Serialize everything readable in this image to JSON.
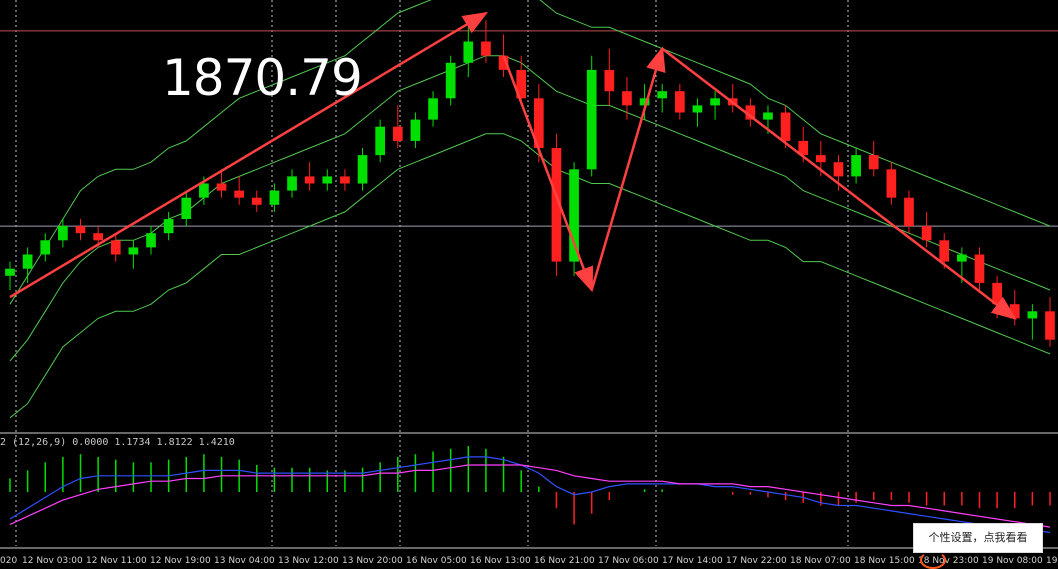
{
  "overlay_text": {
    "price_label": "1870.79",
    "indicator_label": "2 (12,26,9) 0.0000 1.1734 1.8122 1.4210",
    "toast_label": "个性设置，点我看看"
  },
  "colors": {
    "background": "#000000",
    "bull_candle": "#00e000",
    "bear_candle": "#ff2020",
    "band_line": "#50c850",
    "arrow": "#ff4040",
    "grid": "#c8c8c8",
    "macd_main": "#3050ff",
    "macd_signal": "#ff40ff"
  },
  "icons": {
    "toast_tail": "orange-arc-icon"
  },
  "chart_data": [
    {
      "type": "candlestick",
      "title": "",
      "x_tick_labels": [
        "020",
        "12 Nov 03:00",
        "12 Nov 11:00",
        "12 Nov 19:00",
        "13 Nov 04:00",
        "13 Nov 12:00",
        "13 Nov 20:00",
        "16 Nov 05:00",
        "16 Nov 13:00",
        "16 Nov 21:00",
        "17 Nov 06:00",
        "17 Nov 14:00",
        "17 Nov 22:00",
        "18 Nov 07:00",
        "18 Nov 15:00",
        "18 Nov 23:00",
        "19 Nov 08:00",
        "19"
      ],
      "vertical_grid_at_ticks": [
        1,
        5,
        6,
        7,
        9,
        11,
        14
      ],
      "y_range": [
        1840,
        1900
      ],
      "horizontal_lines": [
        1896.5,
        1869.0
      ],
      "annotation_price": 1870.79,
      "ohlc": [
        [
          1862,
          1864,
          1860,
          1863
        ],
        [
          1863,
          1866,
          1861,
          1865
        ],
        [
          1865,
          1868,
          1864,
          1867
        ],
        [
          1867,
          1870,
          1866,
          1869
        ],
        [
          1869,
          1870,
          1867,
          1868
        ],
        [
          1868,
          1869,
          1866,
          1867
        ],
        [
          1867,
          1868,
          1864,
          1865
        ],
        [
          1865,
          1867,
          1863,
          1866
        ],
        [
          1866,
          1869,
          1865,
          1868
        ],
        [
          1868,
          1871,
          1867,
          1870
        ],
        [
          1870,
          1874,
          1869,
          1873
        ],
        [
          1873,
          1876,
          1872,
          1875
        ],
        [
          1875,
          1877,
          1873,
          1874
        ],
        [
          1874,
          1876,
          1872,
          1873
        ],
        [
          1873,
          1874,
          1871,
          1872
        ],
        [
          1872,
          1875,
          1871,
          1874
        ],
        [
          1874,
          1877,
          1873,
          1876
        ],
        [
          1876,
          1878,
          1874,
          1875
        ],
        [
          1875,
          1877,
          1874,
          1876
        ],
        [
          1876,
          1877,
          1874,
          1875
        ],
        [
          1875,
          1880,
          1874,
          1879
        ],
        [
          1879,
          1884,
          1878,
          1883
        ],
        [
          1883,
          1886,
          1880,
          1881
        ],
        [
          1881,
          1885,
          1880,
          1884
        ],
        [
          1884,
          1888,
          1883,
          1887
        ],
        [
          1887,
          1893,
          1886,
          1892
        ],
        [
          1892,
          1897,
          1890,
          1895
        ],
        [
          1895,
          1898,
          1892,
          1893
        ],
        [
          1893,
          1896,
          1890,
          1891
        ],
        [
          1891,
          1893,
          1886,
          1887
        ],
        [
          1887,
          1889,
          1878,
          1880
        ],
        [
          1880,
          1882,
          1862,
          1864
        ],
        [
          1864,
          1878,
          1862,
          1877
        ],
        [
          1877,
          1893,
          1876,
          1891
        ],
        [
          1891,
          1894,
          1886,
          1888
        ],
        [
          1888,
          1890,
          1884,
          1886
        ],
        [
          1886,
          1889,
          1884,
          1887
        ],
        [
          1887,
          1889,
          1885,
          1888
        ],
        [
          1888,
          1889,
          1884,
          1885
        ],
        [
          1885,
          1887,
          1883,
          1886
        ],
        [
          1886,
          1888,
          1884,
          1887
        ],
        [
          1887,
          1889,
          1885,
          1886
        ],
        [
          1886,
          1887,
          1883,
          1884
        ],
        [
          1884,
          1886,
          1882,
          1885
        ],
        [
          1885,
          1886,
          1880,
          1881
        ],
        [
          1881,
          1883,
          1878,
          1879
        ],
        [
          1879,
          1881,
          1876,
          1878
        ],
        [
          1878,
          1879,
          1874,
          1876
        ],
        [
          1876,
          1880,
          1875,
          1879
        ],
        [
          1879,
          1881,
          1876,
          1877
        ],
        [
          1877,
          1878,
          1872,
          1873
        ],
        [
          1873,
          1874,
          1868,
          1869
        ],
        [
          1869,
          1871,
          1866,
          1867
        ],
        [
          1867,
          1868,
          1863,
          1864
        ],
        [
          1864,
          1866,
          1861,
          1865
        ],
        [
          1865,
          1866,
          1860,
          1861
        ],
        [
          1861,
          1862,
          1856,
          1858
        ],
        [
          1858,
          1860,
          1855,
          1856
        ],
        [
          1856,
          1858,
          1853,
          1857
        ],
        [
          1857,
          1859,
          1852,
          1853
        ]
      ],
      "bollinger": {
        "upper": [
          1858,
          1862,
          1866,
          1870,
          1874,
          1876,
          1877,
          1877,
          1878,
          1880,
          1881,
          1883,
          1885,
          1887,
          1888,
          1889,
          1890,
          1891,
          1892,
          1893,
          1895,
          1897,
          1899,
          1900,
          1901,
          1902,
          1903,
          1904,
          1904,
          1903,
          1901,
          1899,
          1898,
          1897,
          1897,
          1896,
          1895,
          1894,
          1893,
          1892,
          1891,
          1890,
          1889,
          1887,
          1886,
          1884,
          1882,
          1881,
          1880,
          1879,
          1878,
          1877,
          1876,
          1875,
          1874,
          1873,
          1872,
          1871,
          1870,
          1869
        ],
        "middle": [
          1850,
          1853,
          1857,
          1861,
          1864,
          1866,
          1867,
          1867,
          1868,
          1870,
          1871,
          1873,
          1875,
          1876,
          1877,
          1878,
          1879,
          1880,
          1881,
          1882,
          1884,
          1886,
          1888,
          1889,
          1890,
          1891,
          1892,
          1893,
          1893,
          1892,
          1890,
          1888,
          1887,
          1886,
          1886,
          1885,
          1884,
          1883,
          1882,
          1881,
          1880,
          1879,
          1878,
          1877,
          1876,
          1874,
          1873,
          1872,
          1871,
          1870,
          1869,
          1868,
          1867,
          1866,
          1865,
          1864,
          1863,
          1862,
          1861,
          1860
        ],
        "lower": [
          1842,
          1844,
          1848,
          1852,
          1854,
          1856,
          1857,
          1857,
          1858,
          1860,
          1861,
          1863,
          1865,
          1865,
          1866,
          1867,
          1868,
          1869,
          1870,
          1871,
          1873,
          1875,
          1877,
          1878,
          1879,
          1880,
          1881,
          1882,
          1882,
          1881,
          1879,
          1877,
          1876,
          1875,
          1875,
          1874,
          1873,
          1872,
          1871,
          1870,
          1869,
          1868,
          1867,
          1867,
          1866,
          1864,
          1864,
          1863,
          1862,
          1861,
          1860,
          1859,
          1858,
          1857,
          1856,
          1855,
          1854,
          1853,
          1852,
          1851
        ]
      },
      "trend_arrows": [
        {
          "from": [
            0,
            1859
          ],
          "to": [
            27,
            1899
          ]
        },
        {
          "from": [
            28,
            1893
          ],
          "to": [
            33,
            1860
          ]
        },
        {
          "from": [
            33,
            1860
          ],
          "to": [
            37,
            1894
          ]
        },
        {
          "from": [
            37,
            1894
          ],
          "to": [
            57,
            1856
          ]
        }
      ]
    },
    {
      "type": "macd",
      "title": "",
      "histogram": [
        0.5,
        0.8,
        1.1,
        1.3,
        1.4,
        1.3,
        1.2,
        1.1,
        1.1,
        1.2,
        1.3,
        1.4,
        1.3,
        1.2,
        1.0,
        0.9,
        0.9,
        0.9,
        0.8,
        0.8,
        0.9,
        1.1,
        1.3,
        1.4,
        1.5,
        1.6,
        1.7,
        1.6,
        1.3,
        0.8,
        0.2,
        -0.6,
        -1.2,
        -0.8,
        -0.3,
        0.0,
        0.1,
        0.1,
        0.0,
        0.0,
        0.0,
        -0.1,
        -0.1,
        -0.2,
        -0.3,
        -0.4,
        -0.5,
        -0.5,
        -0.4,
        -0.3,
        -0.3,
        -0.4,
        -0.5,
        -0.5,
        -0.5,
        -0.6,
        -0.6,
        -0.6,
        -0.5,
        -0.5
      ],
      "main": [
        -1.0,
        -0.6,
        -0.2,
        0.2,
        0.5,
        0.6,
        0.6,
        0.6,
        0.6,
        0.6,
        0.7,
        0.8,
        0.8,
        0.8,
        0.7,
        0.7,
        0.7,
        0.7,
        0.7,
        0.7,
        0.7,
        0.8,
        0.9,
        1.0,
        1.1,
        1.2,
        1.3,
        1.3,
        1.2,
        1.0,
        0.7,
        0.2,
        -0.1,
        0.0,
        0.2,
        0.3,
        0.3,
        0.3,
        0.3,
        0.3,
        0.2,
        0.2,
        0.1,
        0.0,
        -0.1,
        -0.2,
        -0.4,
        -0.5,
        -0.5,
        -0.6,
        -0.7,
        -0.8,
        -0.9,
        -1.0,
        -1.1,
        -1.2,
        -1.3,
        -1.4,
        -1.4,
        -1.5
      ],
      "signal": [
        -1.2,
        -0.9,
        -0.6,
        -0.3,
        -0.1,
        0.1,
        0.2,
        0.3,
        0.4,
        0.4,
        0.5,
        0.5,
        0.6,
        0.6,
        0.6,
        0.6,
        0.6,
        0.6,
        0.6,
        0.6,
        0.6,
        0.7,
        0.7,
        0.8,
        0.8,
        0.9,
        1.0,
        1.0,
        1.0,
        1.0,
        0.9,
        0.8,
        0.6,
        0.5,
        0.4,
        0.4,
        0.4,
        0.4,
        0.3,
        0.3,
        0.3,
        0.3,
        0.2,
        0.2,
        0.1,
        0.0,
        -0.1,
        -0.2,
        -0.3,
        -0.4,
        -0.5,
        -0.5,
        -0.6,
        -0.7,
        -0.8,
        -0.9,
        -1.0,
        -1.1,
        -1.2,
        -1.3
      ],
      "y_range": [
        -2,
        2
      ]
    }
  ]
}
